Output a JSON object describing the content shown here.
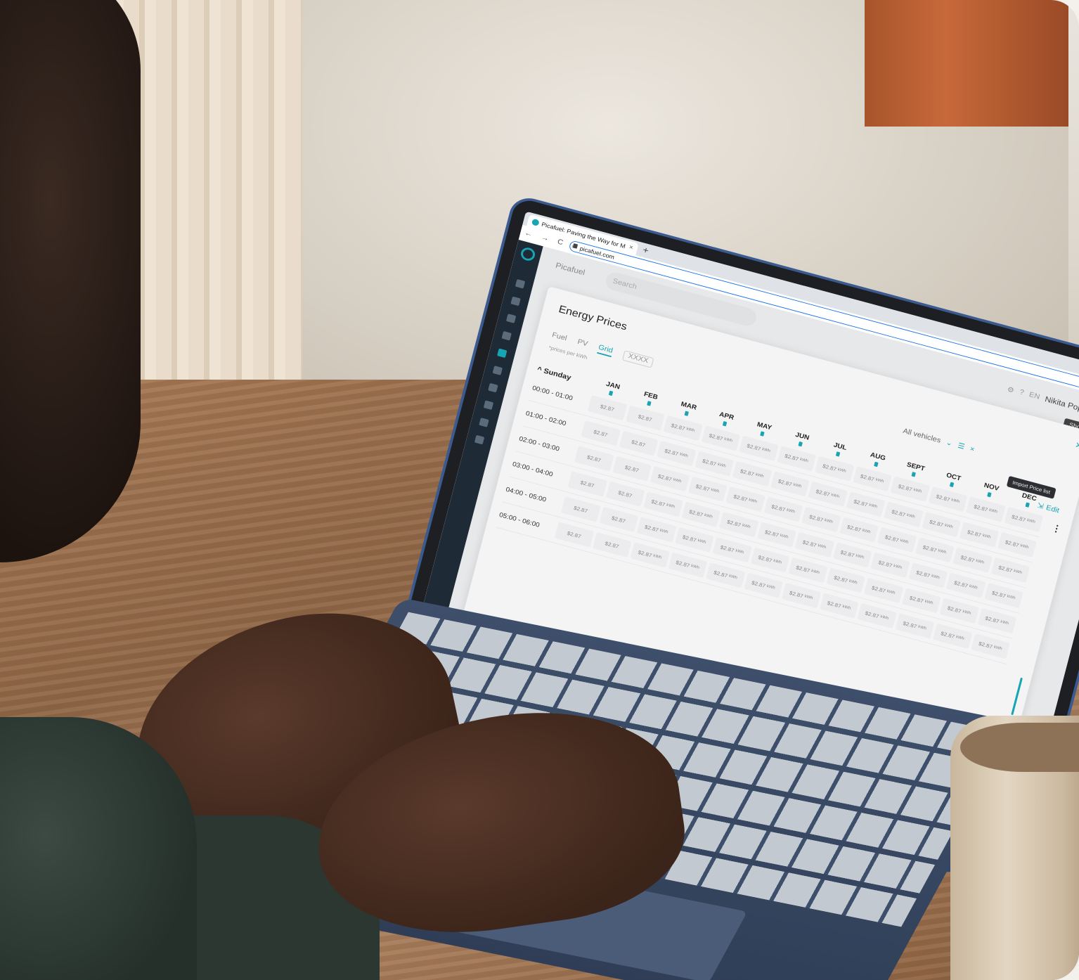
{
  "browser": {
    "tab_title": "Picafuel: Paving the Way for M",
    "tab_close": "×",
    "new_tab": "+",
    "nav": "← → C ⌂",
    "url": "picafuel.com",
    "icons": "⇪ ☆"
  },
  "app": {
    "logo_text": "Picafuel",
    "search_placeholder": "Search",
    "language": "EN",
    "user_name": "Nikita Poputko",
    "show_map_label": "Show on map"
  },
  "modal": {
    "title": "Energy Prices",
    "close": "×",
    "tabs": [
      "Fuel",
      "PV",
      "Grid",
      "XXXX"
    ],
    "active_tab": "Grid",
    "note": "*prices per kWh",
    "vehicle_filter": "All vehicles",
    "tooltip": "Import Price list",
    "edit_label": "Edit",
    "more": "⋮"
  },
  "grid": {
    "day": "Sunday",
    "months": [
      "JAN",
      "FEB",
      "MAR",
      "APR",
      "MAY",
      "JUN",
      "JUL",
      "AUG",
      "SEPT",
      "OCT",
      "NOV",
      "DEC"
    ],
    "price": "$2.87",
    "unit": "kWh",
    "rows": [
      {
        "time": "00:00 - 01:00"
      },
      {
        "time": "01:00 - 02:00"
      },
      {
        "time": "02:00 - 03:00"
      },
      {
        "time": "03:00 - 04:00"
      },
      {
        "time": "04:00 - 05:00"
      },
      {
        "time": "05:00 - 06:00"
      }
    ]
  },
  "colors": {
    "accent": "#17a4b3",
    "sidebar": "#1e2a36",
    "device_edge": "#3a5a90"
  }
}
